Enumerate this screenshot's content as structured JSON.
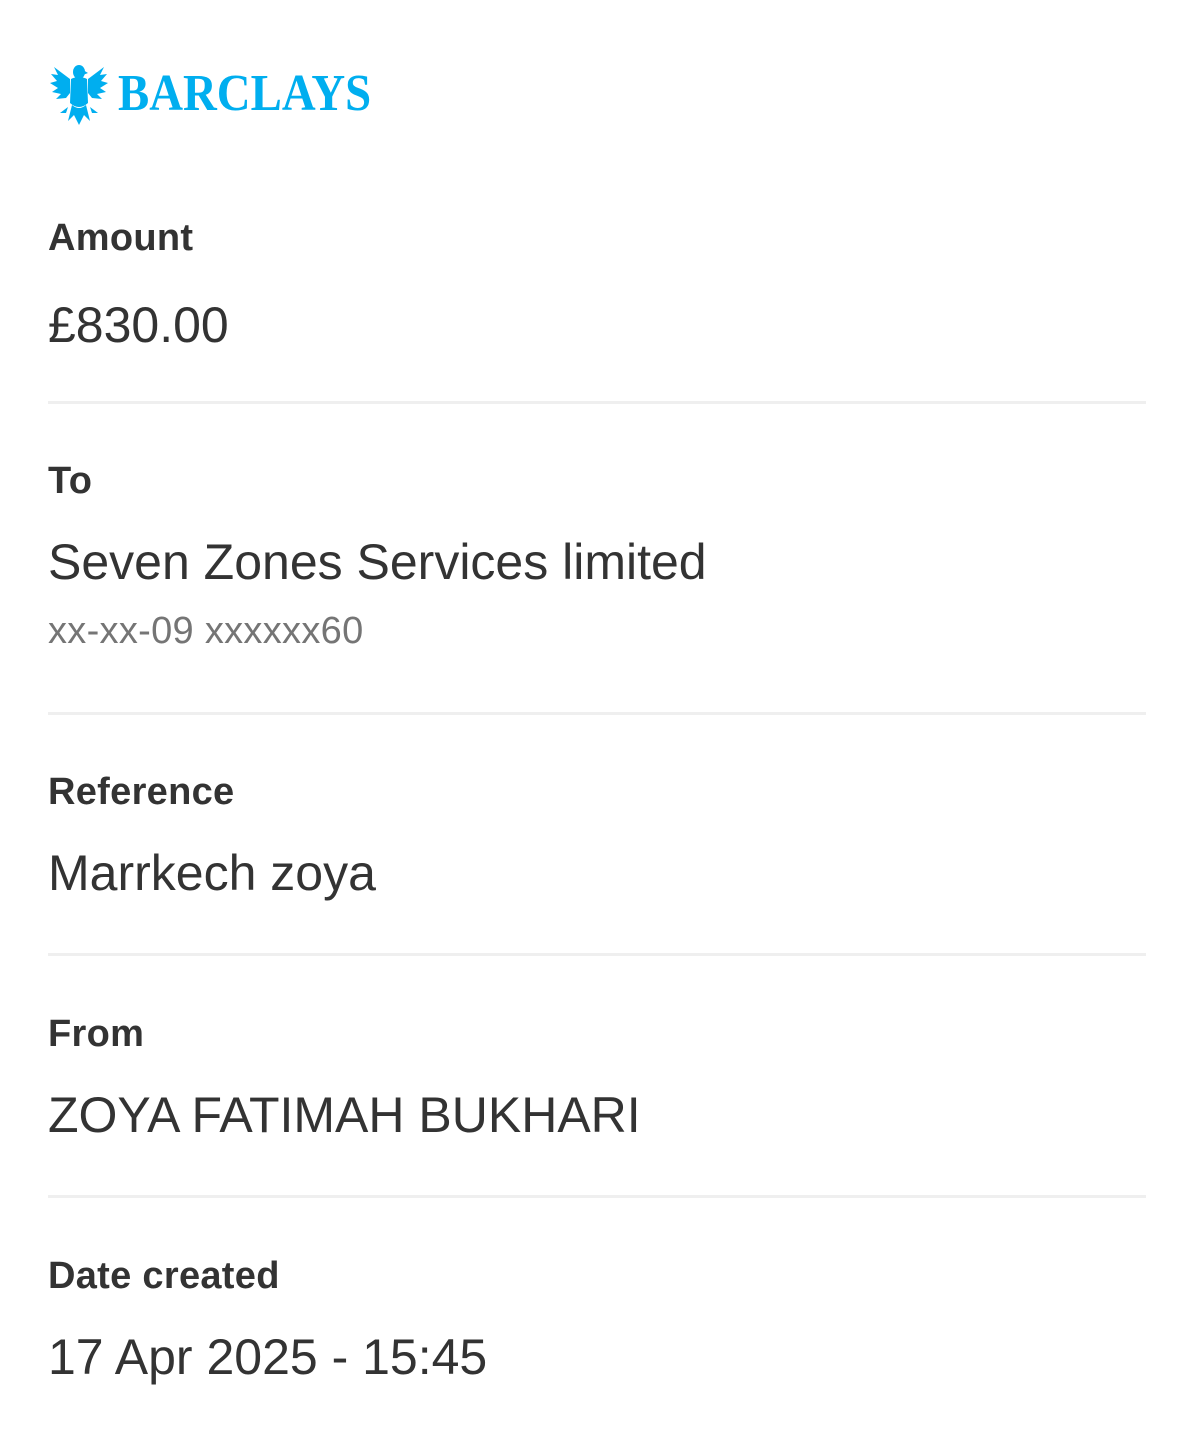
{
  "brand": {
    "name": "BARCLAYS",
    "logo_icon": "eagle-icon",
    "color": "#00aeef"
  },
  "amount": {
    "label": "Amount",
    "value": "£830.00"
  },
  "to": {
    "label": "To",
    "value": "Seven Zones Services limited",
    "account": "xx-xx-09 xxxxxx60"
  },
  "reference": {
    "label": "Reference",
    "value": "Marrkech zoya"
  },
  "from": {
    "label": "From",
    "value": "ZOYA FATIMAH BUKHARI"
  },
  "date_created": {
    "label": "Date created",
    "value": "17 Apr 2025 - 15:45"
  }
}
